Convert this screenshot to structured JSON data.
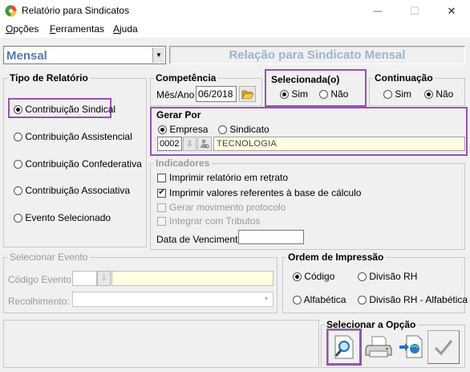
{
  "window": {
    "title": "Relatório para Sindicatos",
    "minimize_glyph": "—",
    "maximize_glyph": "☐",
    "close_glyph": "✕"
  },
  "menu": [
    "Opções",
    "Ferramentas",
    "Ajuda"
  ],
  "mode": {
    "value": "Mensal",
    "report_title": "Relação para Sindicato Mensal"
  },
  "tipo": {
    "label": "Tipo de Relatório",
    "options": [
      "Contribuição Sindical",
      "Contribuição Assistencial",
      "Contribuição Confederativa",
      "Contribuição Associativa",
      "Evento Selecionado"
    ],
    "selected": 0
  },
  "competencia": {
    "label": "Competência",
    "field_label": "Mês/Ano",
    "value": "06/2018"
  },
  "selecionada": {
    "label": "Selecionada(o)",
    "sim": "Sim",
    "nao": "Não",
    "selected": "sim"
  },
  "continuacao": {
    "label": "Continuação",
    "sim": "Sim",
    "nao": "Não",
    "selected": "nao"
  },
  "gerar": {
    "label": "Gerar Por",
    "empresa": "Empresa",
    "sindicato": "Sindicato",
    "selected": "empresa",
    "code": "0002",
    "name": "TECNOLOGIA"
  },
  "indicadores": {
    "label": "Indicadores",
    "items": [
      {
        "label": "Imprimir relatório em retrato",
        "checked": false,
        "enabled": true
      },
      {
        "label": "Imprimir valores referentes à base de cálculo",
        "checked": true,
        "enabled": true
      },
      {
        "label": "Gerar movimento protocolo",
        "checked": false,
        "enabled": false
      },
      {
        "label": "Integrar com Tributos",
        "checked": false,
        "enabled": false
      }
    ],
    "vencimento_label": "Data de Vencimento",
    "vencimento_value": ""
  },
  "evento": {
    "label": "Selecionar Evento",
    "codigo_label": "Código Evento:",
    "recolhimento_label": "Recolhimento:"
  },
  "ordem": {
    "label": "Ordem de Impressão",
    "options": [
      "Código",
      "Divisão RH",
      "Alfabética",
      "Divisão RH - Alfabética"
    ],
    "selected": 0
  },
  "opcao": {
    "label": "Selecionar a Opção",
    "buttons": [
      "preview-icon",
      "printer-icon",
      "export-icon",
      "confirm-icon"
    ]
  },
  "colors": {
    "highlight": "#9b4fb8",
    "mode_text": "#5a7ab0",
    "title_text": "#9cb3d1",
    "field_yellow": "#ffffe1"
  }
}
